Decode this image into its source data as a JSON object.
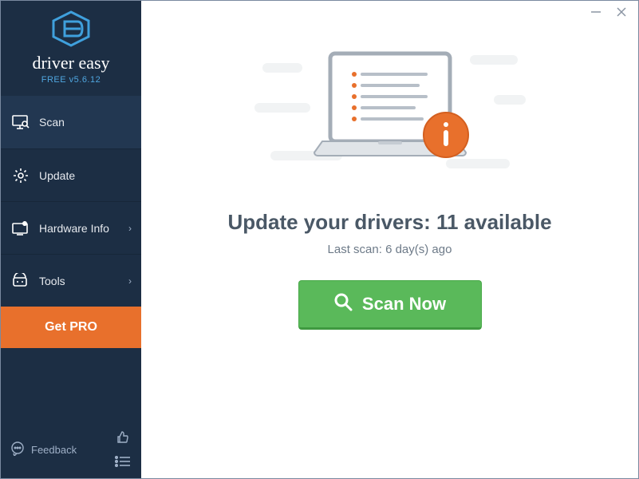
{
  "brand": {
    "name": "driver easy",
    "subline": "FREE v5.6.12"
  },
  "nav": {
    "scan": "Scan",
    "update": "Update",
    "hardware": "Hardware Info",
    "tools": "Tools"
  },
  "get_pro": "Get PRO",
  "footer": {
    "feedback": "Feedback"
  },
  "main": {
    "headline": "Update your drivers: 11 available",
    "subhead": "Last scan: 6 day(s) ago",
    "scan_button": "Scan Now"
  }
}
